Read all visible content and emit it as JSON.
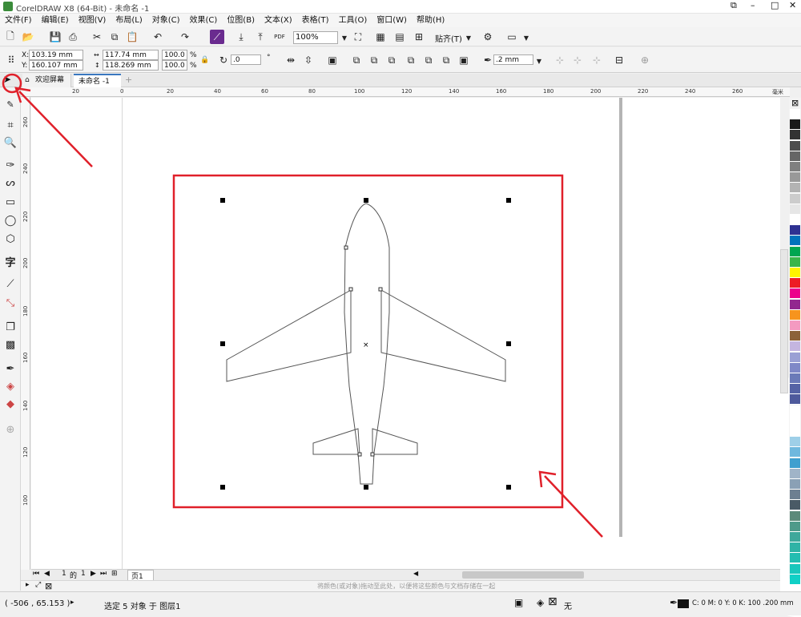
{
  "app": {
    "title": "CorelDRAW X8 (64-Bit) - 未命名 -1"
  },
  "menu": [
    "文件(F)",
    "编辑(E)",
    "视图(V)",
    "布局(L)",
    "对象(C)",
    "效果(C)",
    "位图(B)",
    "文本(X)",
    "表格(T)",
    "工具(O)",
    "窗口(W)",
    "帮助(H)"
  ],
  "toolbar": {
    "zoom": "100%",
    "snap_label": "贴齐(T)",
    "pdf_label": "PDF"
  },
  "properties": {
    "x_label": "X:",
    "x_value": "103.19 mm",
    "y_label": "Y:",
    "y_value": "160.107 mm",
    "w_value": "117.74 mm",
    "h_value": "118.269 mm",
    "scale_x": "100.0",
    "scale_y": "100.0",
    "pct": "%",
    "angle": ".0",
    "outline": ".2 mm"
  },
  "tabs": {
    "welcome": "欢迎屏幕",
    "doc": "未命名 -1"
  },
  "ruler": {
    "h_ticks": [
      "20",
      "0",
      "20",
      "40",
      "60",
      "80",
      "100",
      "120",
      "140",
      "160",
      "180",
      "200",
      "220",
      "240",
      "260"
    ],
    "unit": "毫米",
    "v_ticks": [
      "260",
      "240",
      "220",
      "200",
      "180",
      "160",
      "140",
      "120",
      "100"
    ]
  },
  "page_nav": {
    "current": "1",
    "of": "的",
    "total": "1",
    "page_tab": "页1"
  },
  "color_hint": "将颜色(或对象)拖动至此处，以便将这些颜色与文档存储在一起",
  "status": {
    "coords": "( -506 , 65.153 )",
    "selection": "选定 5 对象 于 图层1",
    "fill_none": "无",
    "outline_color": "C: 0 M: 0 Y: 0 K: 100  .200 mm"
  },
  "palette": [
    "#ffffff",
    "#1a1a1a",
    "#333333",
    "#4d4d4d",
    "#666666",
    "#808080",
    "#999999",
    "#b3b3b3",
    "#cccccc",
    "#e6e6e6",
    "#ffffff",
    "#2e3192",
    "#0072bc",
    "#00a651",
    "#39b54a",
    "#fff200",
    "#ed1c24",
    "#ec008c",
    "#92278f",
    "#f7941d",
    "#f49ac1",
    "#8c6239",
    "#c4b5e0",
    "#9aa0d4",
    "#7f88c7",
    "#6b7ab8",
    "#5563a5",
    "#4e5a9c",
    "#ffffff",
    "#ffffff",
    "#ffffff",
    "#9ecfe8",
    "#6fb8de",
    "#3f9fcf",
    "#a0b4c8",
    "#8aa0b5",
    "#6d7f91",
    "#4a5a66",
    "#5c8a7a",
    "#4e9a8a",
    "#3ea89b",
    "#2fb3a6",
    "#23bdb1",
    "#18c7bc",
    "#10d0c6"
  ],
  "annotation_colors": {
    "red": "#e0202a"
  }
}
